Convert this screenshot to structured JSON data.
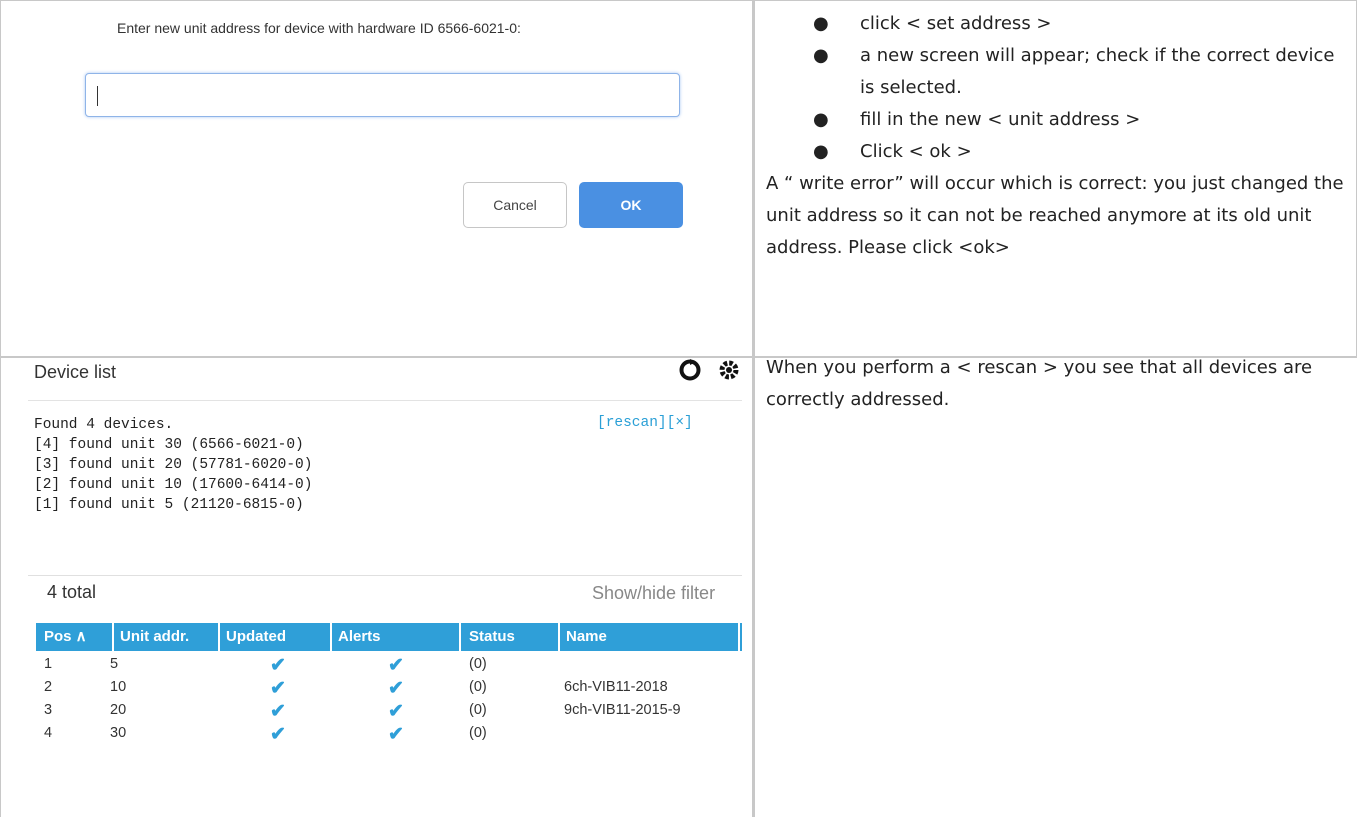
{
  "dialog": {
    "prompt": "Enter new unit address for device with hardware ID 6566-6021-0:",
    "input_value": "",
    "cancel_label": "Cancel",
    "ok_label": "OK"
  },
  "instructions": {
    "bullets": [
      "click < set address >",
      "a new screen will appear; check if the correct device is selected.",
      "fill in the new < unit address >",
      "Click < ok >"
    ],
    "note": "A “ write error” will occur which is correct: you just changed the unit address so it can not be reached anymore at its old unit address. Please click <ok>",
    "rescan_note": "When you perform a < rescan > you see that all devices are correctly addressed."
  },
  "device_list": {
    "title": "Device list",
    "icons": [
      "refresh-icon",
      "gear-icon"
    ],
    "log": "Found 4 devices.\n[4] found unit 30 (6566-6021-0)\n[3] found unit 20 (57781-6020-0)\n[2] found unit 10 (17600-6414-0)\n[1] found unit 5 (21120-6815-0)",
    "rescan_label": "[rescan]",
    "close_label": "[×]",
    "total": "4 total",
    "filter_label": "Show/hide filter",
    "columns": [
      "Pos ∧",
      "Unit addr.",
      "Updated",
      "Alerts",
      "Status",
      "Name"
    ],
    "rows": [
      {
        "pos": "1",
        "unit": "5",
        "status": "(0)",
        "name": ""
      },
      {
        "pos": "2",
        "unit": "10",
        "status": "(0)",
        "name": "6ch-VIB11-2018"
      },
      {
        "pos": "3",
        "unit": "20",
        "status": "(0)",
        "name": "9ch-VIB11-2015-9"
      },
      {
        "pos": "4",
        "unit": "30",
        "status": "(0)",
        "name": ""
      }
    ],
    "accent_color": "#2f9fd8"
  }
}
